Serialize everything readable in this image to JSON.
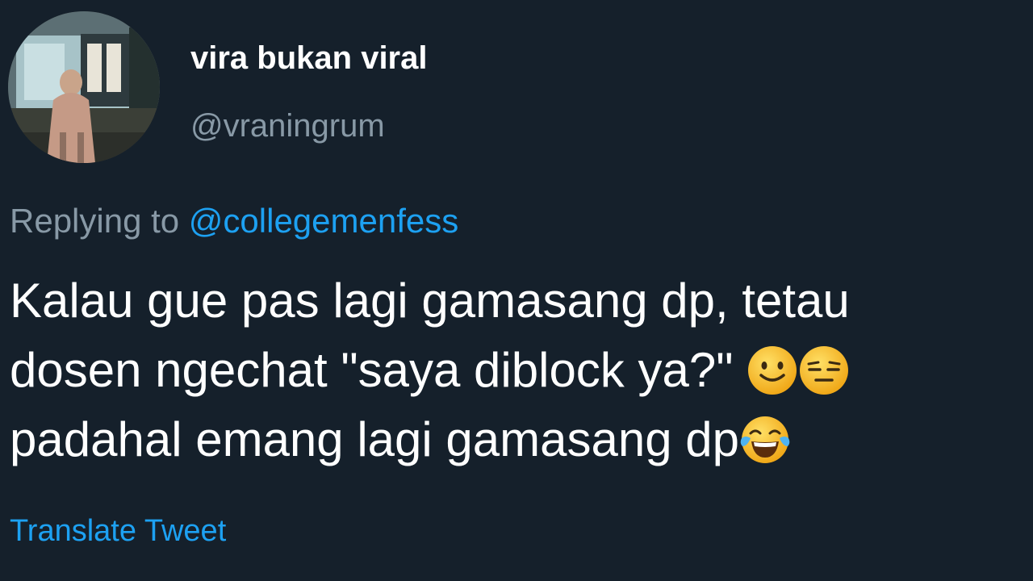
{
  "tweet": {
    "author": {
      "display_name": "vira bukan viral",
      "handle": "@vraningrum"
    },
    "reply": {
      "prefix": "Replying to",
      "mention": "@collegemenfess"
    },
    "text_lines": [
      "Kalau gue pas lagi gamasang dp, tetau",
      "dosen ngechat \"saya diblock ya?\"",
      "padahal emang lagi gamasang dp"
    ],
    "emojis": [
      "slightly-smiling-face",
      "expressionless-face",
      "tears-of-joy-face"
    ],
    "translate_label": "Translate Tweet"
  },
  "colors": {
    "background": "#15202b",
    "primary_text": "#ffffff",
    "secondary_text": "#8899a6",
    "link": "#1da1f2",
    "emoji_yellow": "#fcc21b"
  }
}
